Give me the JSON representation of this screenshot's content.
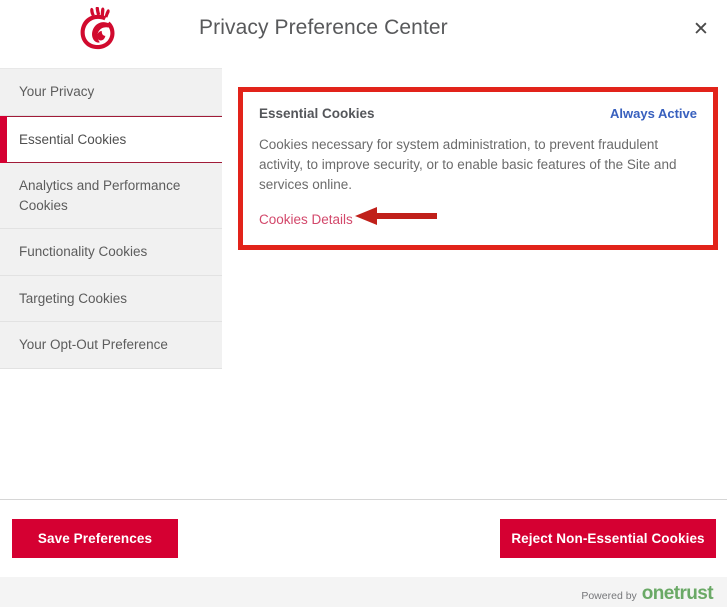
{
  "header": {
    "title": "Privacy Preference Center",
    "logo_icon": "chick-fil-a-logo",
    "close_icon": "✕",
    "close_label": "Close"
  },
  "sidebar": {
    "items": [
      {
        "label": "Your Privacy",
        "active": false
      },
      {
        "label": "Essential Cookies",
        "active": true
      },
      {
        "label": "Analytics and Performance Cookies",
        "active": false
      },
      {
        "label": "Functionality Cookies",
        "active": false
      },
      {
        "label": "Targeting Cookies",
        "active": false
      },
      {
        "label": "Your Opt-Out Preference",
        "active": false
      }
    ]
  },
  "main": {
    "group_title": "Essential Cookies",
    "always_active": "Always Active",
    "description": "Cookies necessary for system administration, to prevent fraudulent activity, to improve security, or to enable basic features of the Site and services online.",
    "cookies_details": "Cookies Details"
  },
  "annotation": {
    "arrow_icon": "left-arrow-annotation",
    "box_color": "#e2231a",
    "arrow_color": "#c0201a"
  },
  "footer": {
    "save_label": "Save Preferences",
    "reject_label": "Reject Non-Essential Cookies",
    "powered_by": "Powered by",
    "brand": "onetrust"
  },
  "colors": {
    "brand_red": "#d50032",
    "link_red": "#d3486b",
    "always_active_blue": "#3860be",
    "onetrust_green": "#6aa966",
    "sidebar_bg": "#f1f1f1"
  }
}
